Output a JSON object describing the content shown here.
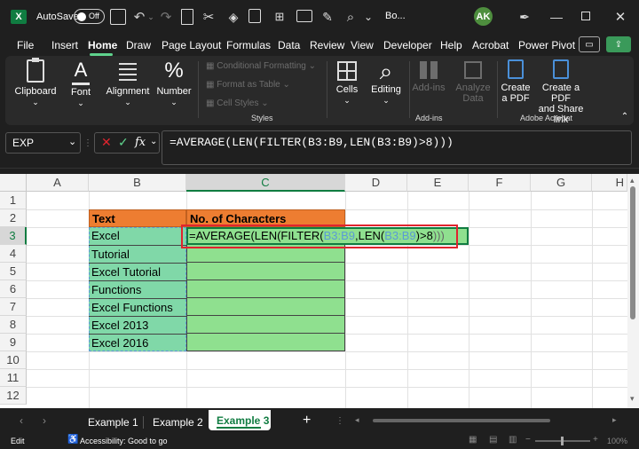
{
  "titlebar": {
    "autosave_label": "AutoSave",
    "autosave_state": "Off",
    "filename": "Bo...",
    "avatar_initials": "AK"
  },
  "menu": [
    "File",
    "Insert",
    "Home",
    "Draw",
    "Page Layout",
    "Formulas",
    "Data",
    "Review",
    "View",
    "Developer",
    "Help",
    "Acrobat",
    "Power Pivot"
  ],
  "ribbon": {
    "clipboard": "Clipboard",
    "font": "Font",
    "alignment": "Alignment",
    "number": "Number",
    "conditional_formatting": "Conditional Formatting",
    "format_as_table": "Format as Table",
    "cell_styles": "Cell Styles",
    "styles_group": "Styles",
    "cells": "Cells",
    "editing": "Editing",
    "addins": "Add-ins",
    "analyze_data_1": "Analyze",
    "analyze_data_2": "Data",
    "addins_group": "Add-ins",
    "create_pdf_1": "Create",
    "create_pdf_2": "a PDF",
    "create_share_1": "Create a PDF",
    "create_share_2": "and Share link",
    "acrobat_group": "Adobe Acrobat"
  },
  "formula_bar": {
    "name_box": "EXP",
    "fx": "fx",
    "formula": "=AVERAGE(LEN(FILTER(B3:B9,LEN(B3:B9)>8)))"
  },
  "grid": {
    "columns": [
      "A",
      "B",
      "C",
      "D",
      "E",
      "F",
      "G",
      "H"
    ],
    "rows": [
      "1",
      "2",
      "3",
      "4",
      "5",
      "6",
      "7",
      "8",
      "9",
      "10",
      "11",
      "12"
    ],
    "header_b": "Text",
    "header_c": "No. of Characters",
    "b_values": [
      "Excel",
      "Tutorial",
      "Excel Tutorial",
      "Functions",
      "Excel Functions",
      "Excel 2013",
      "Excel 2016"
    ],
    "edit_formula": {
      "p1": "=AVERAGE(LEN(FILTER(",
      "ref1": "B3:B9",
      "p2": ",LEN(",
      "ref2": "B3:B9",
      "p3": ")>8",
      "p4": ")))"
    }
  },
  "sheets": [
    "Example 1",
    "Example 2",
    "Example 3"
  ],
  "active_sheet": "Example 3",
  "status": {
    "mode": "Edit",
    "accessibility": "Accessibility: Good to go",
    "zoom": "100%"
  },
  "colors": {
    "orange_header": "#ed7d31",
    "green_fill": "#8fe08f",
    "teal_fill": "#80d8a8",
    "highlight_box": "#e0242e",
    "ref_blue": "#5b9bd5",
    "excel_green": "#107c41"
  }
}
